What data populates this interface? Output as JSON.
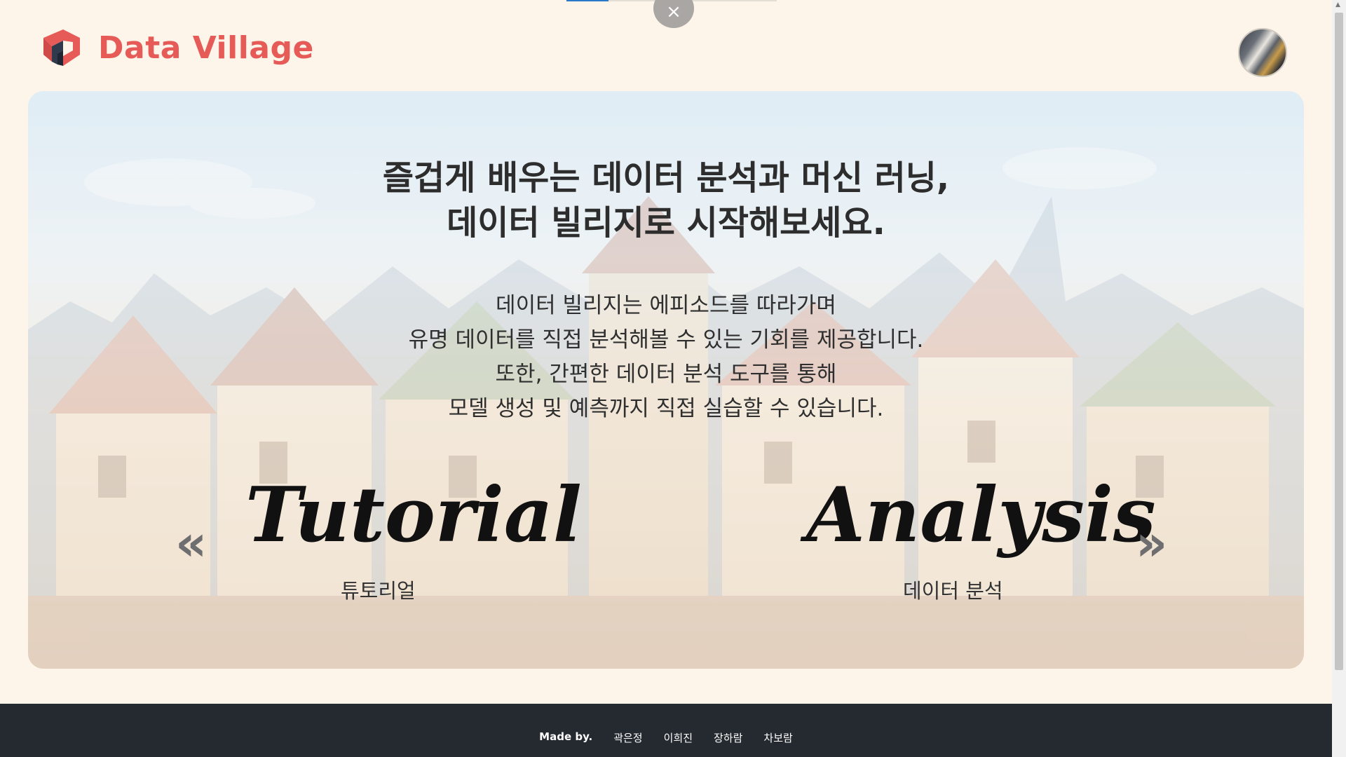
{
  "brand": {
    "name": "Data Village"
  },
  "close_icon_glyph": "×",
  "hero": {
    "title_line1": "즐겁게 배우는 데이터 분석과 머신 러닝,",
    "title_line2": "데이터 빌리지로 시작해보세요.",
    "desc_lines": [
      "데이터 빌리지는 에피소드를 따라가며",
      "유명 데이터를 직접 분석해볼 수 있는 기회를 제공합니다.",
      "또한, 간편한 데이터 분석 도구를 통해",
      "모델 생성 및 예측까지 직접 실습할 수 있습니다."
    ],
    "tutorial": {
      "word": "Tutorial",
      "subtitle": "튜토리얼",
      "chevron": "«"
    },
    "analysis": {
      "word": "Analysis",
      "subtitle": "데이터 분석",
      "chevron": "»"
    }
  },
  "footer": {
    "made_by": "Made by.",
    "authors": [
      "곽은정",
      "이희진",
      "장하람",
      "차보람"
    ]
  },
  "colors": {
    "page_bg": "#fdf5ea",
    "brand": "#e65a58",
    "footer_bg": "#252a30",
    "chevron": "#6e6e70"
  },
  "icons": [
    "close-icon",
    "logo-icon",
    "chevron-left-icon",
    "chevron-right-icon",
    "scroll-up-icon"
  ]
}
